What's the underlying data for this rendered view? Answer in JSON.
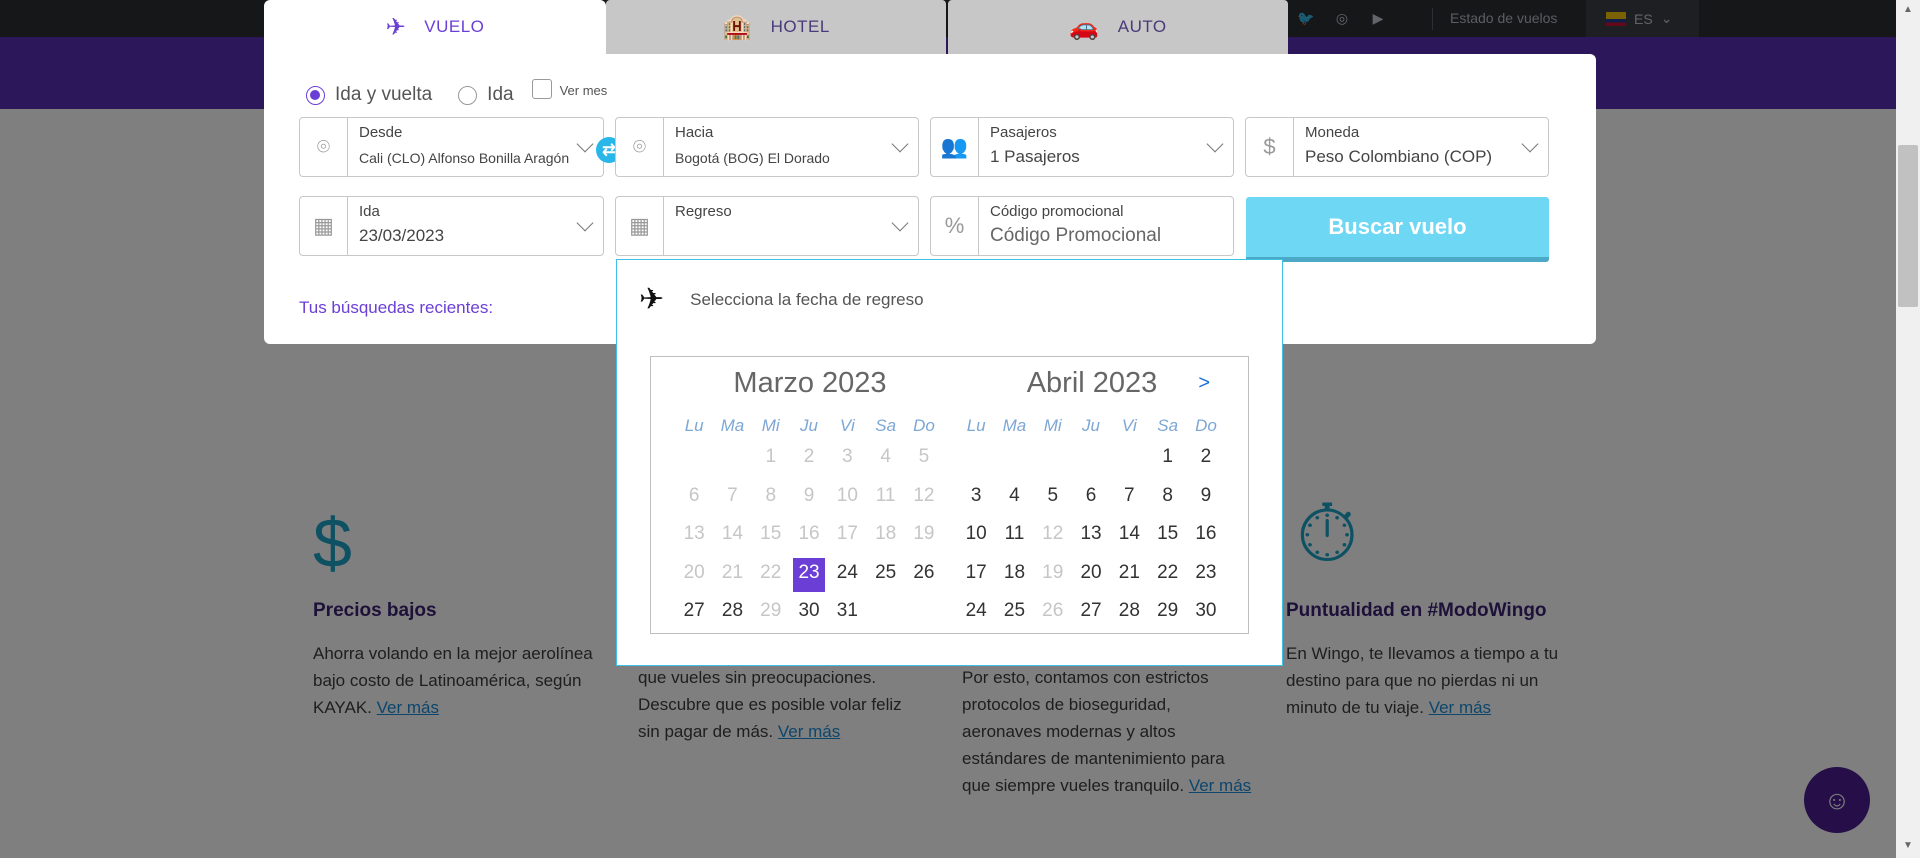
{
  "tabs": [
    {
      "label": "VUELO",
      "icon": "plane-icon"
    },
    {
      "label": "HOTEL",
      "icon": "hotel-icon"
    },
    {
      "label": "AUTO",
      "icon": "car-icon"
    }
  ],
  "topbar": {
    "status_link": "Estado de vuelos",
    "language": "ES",
    "social": [
      "twitter-icon",
      "instagram-icon",
      "youtube-icon"
    ]
  },
  "trip": {
    "round_trip": "Ida y vuelta",
    "one_way": "Ida",
    "see_month": "Ver mes"
  },
  "fields": {
    "from": {
      "label": "Desde",
      "value": "Cali (CLO) Alfonso Bonilla Aragón"
    },
    "to": {
      "label": "Hacia",
      "value": "Bogotá (BOG) El Dorado"
    },
    "passengers": {
      "label": "Pasajeros",
      "value": "1 Pasajeros"
    },
    "currency": {
      "label": "Moneda",
      "value": "Peso Colombiano (COP)"
    },
    "depart": {
      "label": "Ida",
      "value": "23/03/2023"
    },
    "return": {
      "label": "Regreso",
      "value": ""
    },
    "promo": {
      "label": "Código promocional",
      "placeholder": "Código Promocional"
    }
  },
  "search_button": "Buscar vuelo",
  "recent_searches": "Tus búsquedas recientes:",
  "calendar": {
    "prompt": "Selecciona la fecha de regreso",
    "next": ">",
    "weekdays": [
      "Lu",
      "Ma",
      "Mi",
      "Ju",
      "Vi",
      "Sa",
      "Do"
    ],
    "months": [
      {
        "title": "Marzo 2023",
        "offset": 2,
        "days": 31,
        "disabled_before": 23,
        "selected": 23,
        "extra_disabled": [
          29
        ]
      },
      {
        "title": "Abril 2023",
        "offset": 5,
        "days": 30,
        "disabled_before": 1,
        "selected": null,
        "extra_disabled": [
          12,
          19,
          26
        ]
      }
    ]
  },
  "features": [
    {
      "title": "Precios bajos",
      "text": "Ahorra volando en la mejor aerolínea bajo costo de Latinoamérica, según KAYAK.",
      "link": "Ver más"
    },
    {
      "title": "",
      "text": "Somos flexibles y buena onda para que vueles sin preocupaciones. Descubre que es posible volar feliz sin pagar de más.",
      "link": "Ver más"
    },
    {
      "title": "",
      "text": "Nuestra principal prioridad eres tú. Por esto, contamos con estrictos protocolos de bioseguridad, aeronaves modernas y altos estándares de mantenimiento para que siempre vueles tranquilo.",
      "link": "Ver más"
    },
    {
      "title": "Puntualidad en #ModoWingo",
      "text": "En Wingo, te llevamos a tiempo a tu destino para que no pierdas ni un minuto de tu viaje.",
      "link": "Ver más"
    }
  ],
  "colors": {
    "brand": "#6b3fd6",
    "accent": "#29b6e8",
    "button": "#6dd7f4"
  }
}
